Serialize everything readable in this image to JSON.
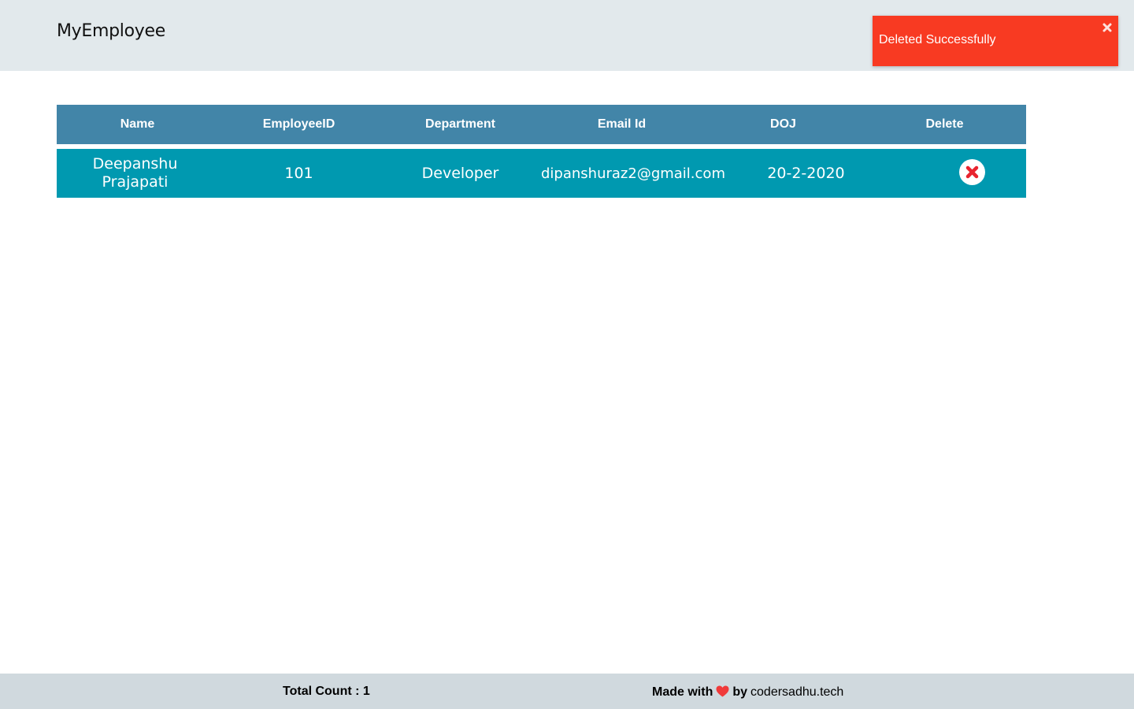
{
  "header": {
    "brand": "MyEmployee"
  },
  "toast": {
    "message": "Deleted Successfully",
    "close_glyph": "✖",
    "color": "#f83a22"
  },
  "table": {
    "columns": [
      "Name",
      "EmployeeID",
      "Department",
      "Email Id",
      "DOJ",
      "Delete"
    ],
    "rows": [
      {
        "name": "Deepanshu Prajapati",
        "employee_id": "101",
        "department": "Developer",
        "email": "dipanshuraz2@gmail.com",
        "doj": "20-2-2020",
        "delete_icon": "close-circle-icon"
      }
    ],
    "header_color": "#4285a8",
    "row_color": "#0099b0"
  },
  "footer": {
    "total_label": "Total Count : 1",
    "made_with": "Made with",
    "by": "by",
    "site": "codersadhu.tech",
    "heart_icon": "heart-icon",
    "heart_color": "#f03a3a"
  }
}
